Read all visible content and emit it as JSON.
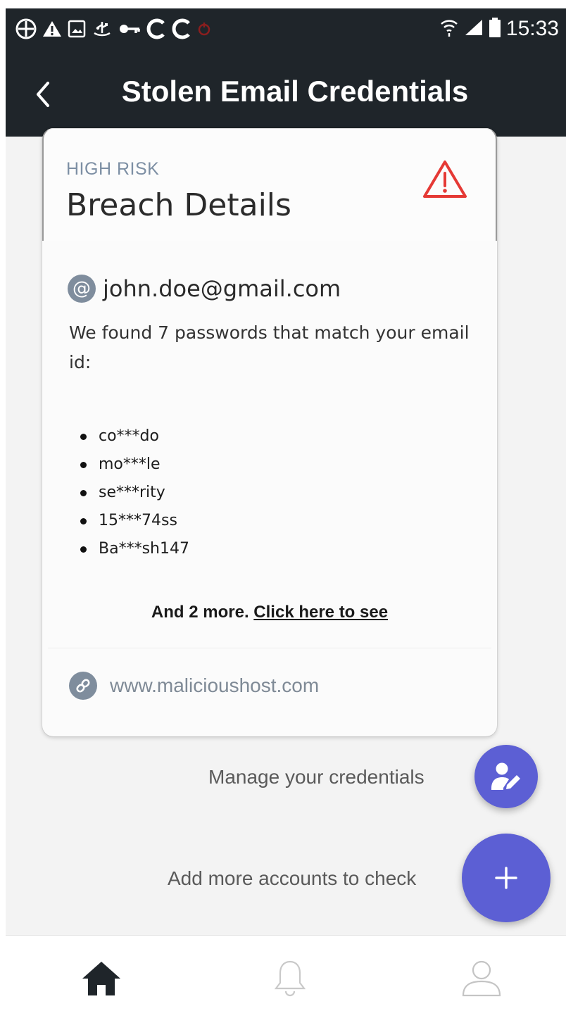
{
  "status_bar": {
    "time": "15:33",
    "icons_left": [
      "game-icon",
      "warning-icon",
      "image-icon",
      "usb-icon",
      "key-icon",
      "c-icon",
      "c-icon",
      "record-icon"
    ],
    "icons_right": [
      "wifi-icon",
      "signal-icon",
      "battery-icon"
    ]
  },
  "app_bar": {
    "title": "Stolen Email Credentials",
    "back_icon": "chevron-left-icon"
  },
  "card": {
    "risk_level": "HIGH RISK",
    "title": "Breach Details",
    "warning_icon": "warning-triangle-icon",
    "warning_color": "#e53935",
    "email": "john.doe@gmail.com",
    "found_text": "We found 7 passwords that match your email id:",
    "passwords": [
      "co***do",
      "mo***le",
      "se***rity",
      "15***74ss",
      "Ba***sh147"
    ],
    "more_prefix": "And 2 more.",
    "more_link": "Click here to see",
    "host": "www.malicioushost.com"
  },
  "actions": {
    "manage_label": "Manage your credentials",
    "add_label": "Add more accounts to check",
    "fab_color": "#5c5fd4"
  },
  "bottom_nav": {
    "items": [
      "home-icon",
      "bell-icon",
      "profile-icon"
    ]
  }
}
